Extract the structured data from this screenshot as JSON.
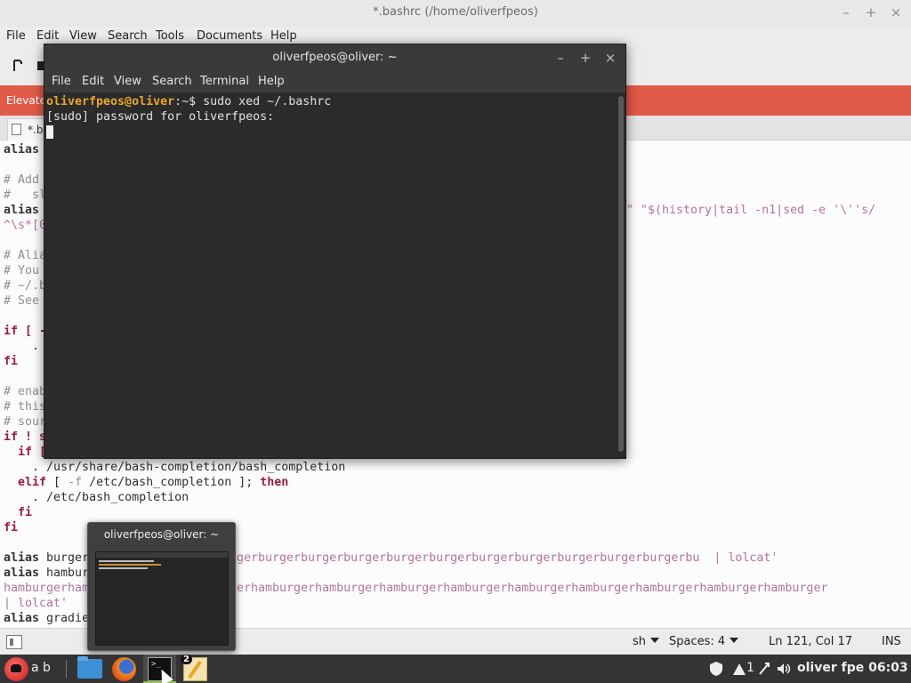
{
  "editor": {
    "window_title": "*.bashrc (/home/oliverfpeos)",
    "menu": [
      "File",
      "Edit",
      "View",
      "Search",
      "Tools",
      "Documents",
      "Help"
    ],
    "elevated_label": "Elevate",
    "tab_label": "*.b",
    "code_lines": {
      "l0": "alias",
      "l1": "# Add",
      "l2": "#   sl",
      "l3": "alias",
      "l3r": "\" \"$(history|tail -n1|sed -e '\\''s/",
      "l4": "^\\s*[0",
      "l5": "# Alia",
      "l6": "# You",
      "l7": "# ~/.b",
      "l8": "# See",
      "l9": "if [ -",
      "l10": "    .",
      "l11": "fi",
      "l12": "# enab",
      "l13": "# this",
      "l14": "# sour",
      "l15": "if ! s",
      "l16": "  if [",
      "l17": "    . /usr/share/bash-completion/bash_completion",
      "l18a": "  elif",
      "l18b": " [ ",
      "l18c": "-f",
      "l18d": " /etc/bash_completion ]; ",
      "l18e": "then",
      "l19": "    . /etc/bash_completion",
      "l20": "  fi",
      "l21": "fi",
      "l22a": "alias",
      "l22b": " burger=",
      "l22c": "gerburgerburgerburgerburgerburgerburgerburgerburgerburgerburgerbu  | lolcat'",
      "l23a": "alias",
      "l23b": " hambur",
      "l24a": "hamburgerham",
      "l24b": "erhamburgerhamburgerhamburgerhamburgerhamburgerhamburgerhamburgerhamburgerhamburger",
      "l25": "| lolcat'",
      "l26a": "alias",
      "l26b": " gradie"
    },
    "status": {
      "lang": "sh",
      "spaces": "Spaces: 4",
      "position": "Ln 121, Col 17",
      "mode": "INS"
    }
  },
  "terminal": {
    "window_title": "oliverfpeos@oliver: ~",
    "menu": [
      "File",
      "Edit",
      "View",
      "Search",
      "Terminal",
      "Help"
    ],
    "prompt_user": "oliverfpeos@oliver",
    "prompt_rest": ":~$ sudo xed ~/.bashrc",
    "line2": "[sudo] password for oliverfpeos:"
  },
  "preview": {
    "title": "oliverfpeos@oliver: ~"
  },
  "taskbar": {
    "menu_text": "a b",
    "badge": "2",
    "term_icon_text": ">_",
    "tray_notify": "1",
    "clock": "oliver fpe 06:03"
  },
  "window_controls": {
    "minimize": "–",
    "maximize": "+",
    "close": "×"
  },
  "icons": [
    "shield-icon",
    "network-icon",
    "bluetooth-icon",
    "volume-icon",
    "folder-icon",
    "firefox-icon",
    "terminal-icon",
    "text-editor-icon",
    "mint-menu-icon"
  ],
  "colors": {
    "elevated_bar": "#e15a48",
    "prompt": "#e9a62a",
    "keyword": "#9b1a4a",
    "string": "#b0759c"
  }
}
